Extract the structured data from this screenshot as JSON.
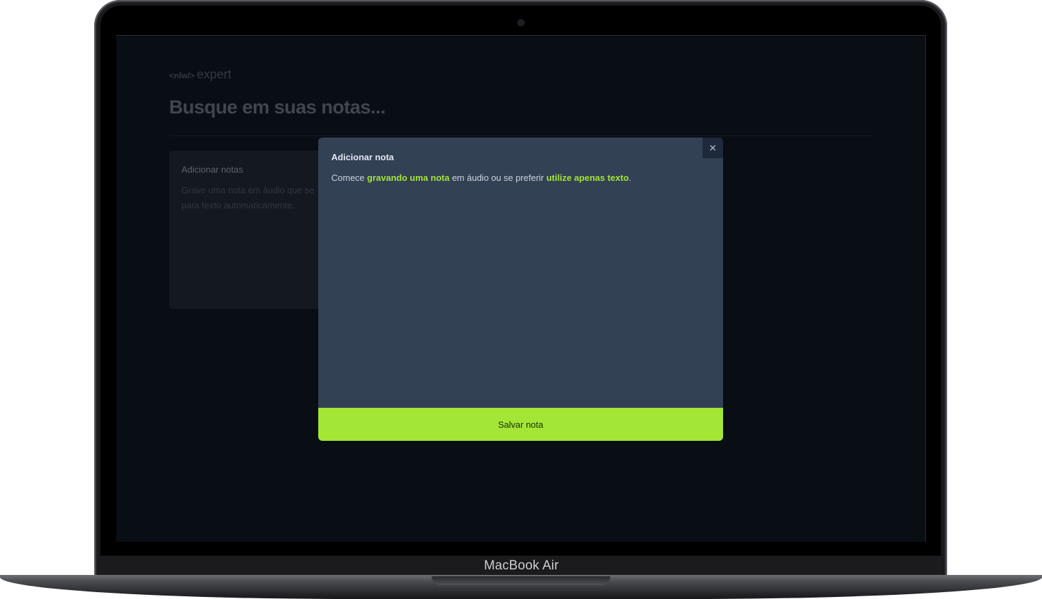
{
  "device": {
    "label": "MacBook Air"
  },
  "app": {
    "logo": {
      "tag": "<nlw/>",
      "word": "expert"
    },
    "search_title": "Busque em suas notas...",
    "add_card": {
      "title": "Adicionar notas",
      "description": "Grave uma nota em áudio que se",
      "description_line2": "para texto automaticamente."
    }
  },
  "modal": {
    "title": "Adicionar nota",
    "text_prefix": "Comece ",
    "link_record": "gravando uma nota",
    "text_middle": " em áudio ou se preferir ",
    "link_text": "utilize apenas texto",
    "text_suffix": ".",
    "close_icon": "✕",
    "save_label": "Salvar nota"
  },
  "colors": {
    "accent": "#a3e635",
    "modal_bg": "#334155",
    "screen_bg": "#090d14"
  }
}
